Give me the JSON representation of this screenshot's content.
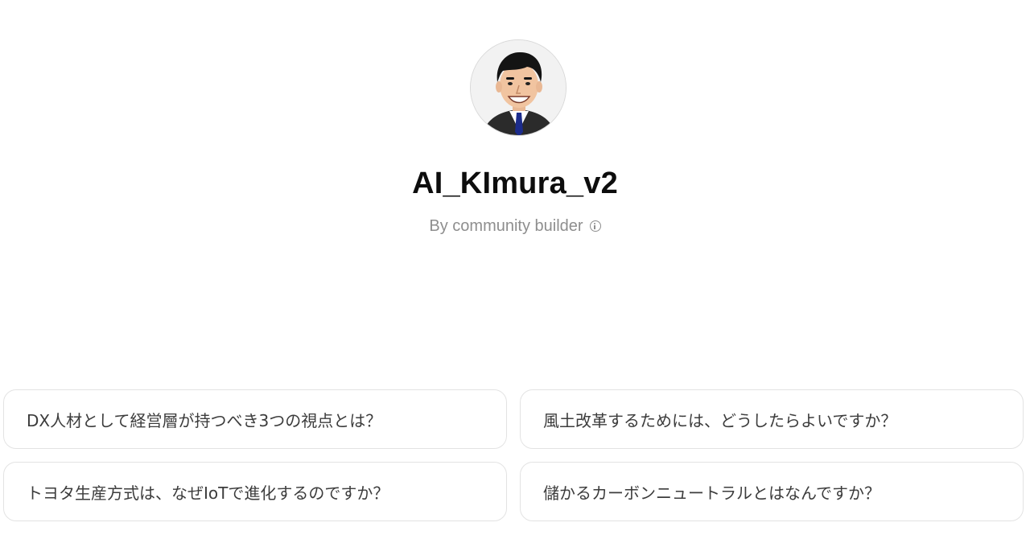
{
  "gpt": {
    "name": "AI_KImura_v2",
    "byline": "By community builder",
    "avatar_icon": "caricature-portrait",
    "info_icon": "info-icon"
  },
  "conversation_starters": [
    {
      "label": "DX人材として経営層が持つべき3つの視点とは？"
    },
    {
      "label": "風土改革するためには、どうしたらよいですか？"
    },
    {
      "label": "トヨタ生産方式は、なぜIoTで進化するのですか？"
    },
    {
      "label": "儲かるカーボンニュートラルとはなんですか？"
    }
  ],
  "colors": {
    "background": "#ffffff",
    "title": "#0d0d0d",
    "byline": "#8e8e8e",
    "card_border": "#e3e3e3",
    "card_text": "#3c3c3c"
  }
}
